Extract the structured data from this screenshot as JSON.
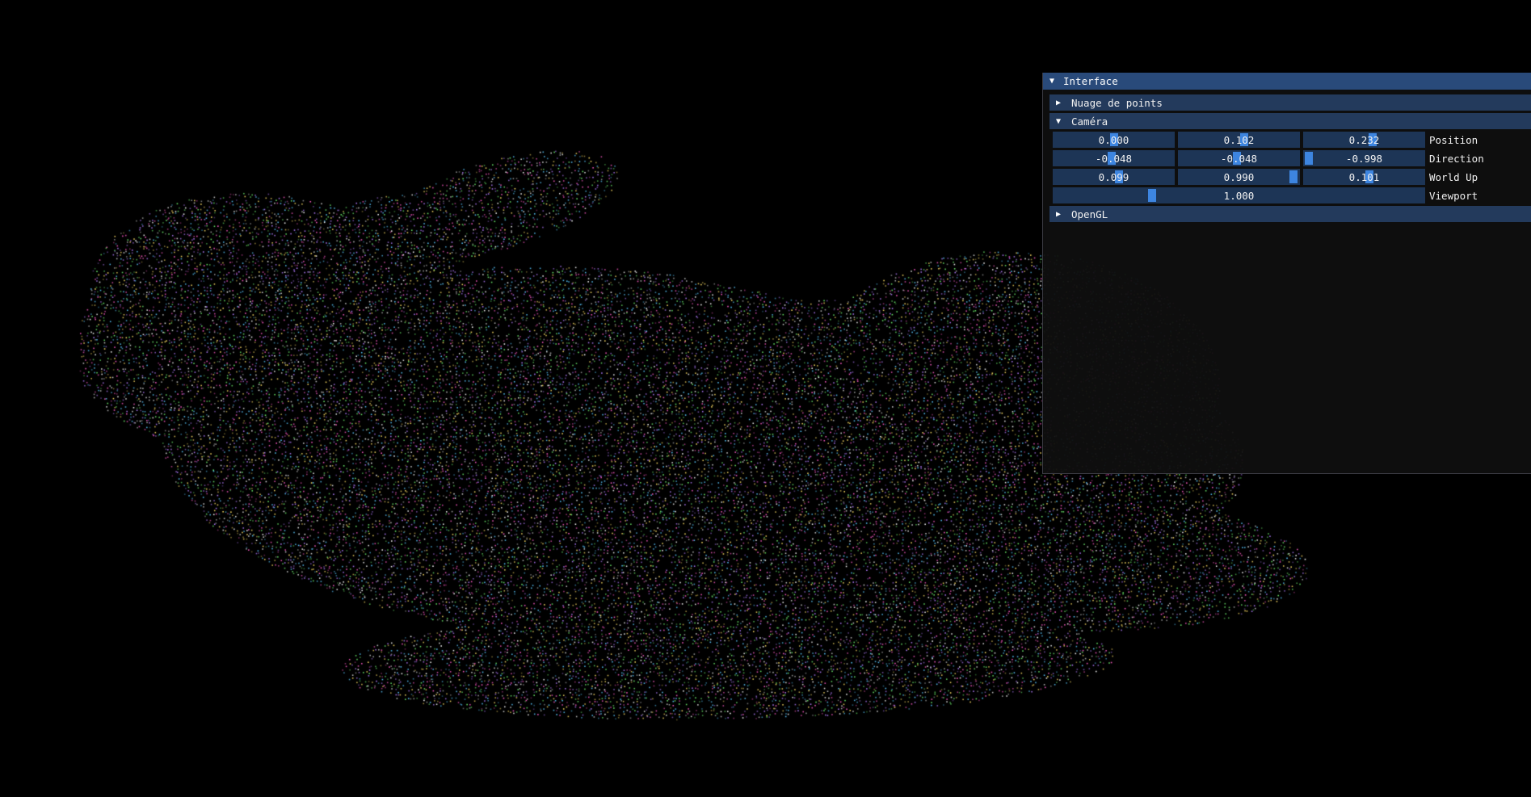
{
  "scene": {
    "description_none": "",
    "point_colors": [
      "#ff5cc8",
      "#6ef06e",
      "#ffffff",
      "#5ac8ff",
      "#ffe066",
      "#b37cff"
    ],
    "background_color": "#000000"
  },
  "window": {
    "title": "Interface",
    "title_icon": "triangle-down-icon",
    "sections": [
      {
        "label": "Nuage de points",
        "icon": "triangle-right-icon",
        "expanded": false
      },
      {
        "label": "Caméra",
        "icon": "triangle-down-icon",
        "expanded": true
      },
      {
        "label": "OpenGL",
        "icon": "triangle-right-icon",
        "expanded": false
      }
    ]
  },
  "camera": {
    "position": {
      "label": "Position",
      "values": [
        "0.000",
        "0.102",
        "0.232"
      ],
      "fractions": [
        0.5,
        0.55,
        0.58
      ]
    },
    "direction": {
      "label": "Direction",
      "values": [
        "-0.048",
        "-0.048",
        "-0.998"
      ],
      "fractions": [
        0.48,
        0.48,
        0.0
      ]
    },
    "world_up": {
      "label": "World Up",
      "values": [
        "0.099",
        "0.990",
        "0.101"
      ],
      "fractions": [
        0.55,
        0.99,
        0.55
      ]
    },
    "viewport": {
      "label": "Viewport",
      "value": "1.000",
      "fraction": 0.26
    }
  },
  "theme": {
    "title_bg": "#294a7a",
    "header_bg": "#233a5c",
    "frame_bg": "#1d3556",
    "grab": "#3d85e0",
    "window_bg": "#0f0f0f"
  }
}
